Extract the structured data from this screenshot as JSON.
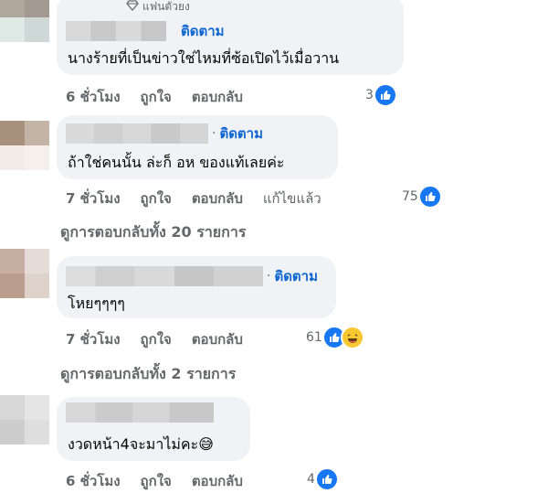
{
  "comments": [
    {
      "badge": "แฟนตัวยง",
      "follow": "ติดตาม",
      "text": "นางร้ายที่เป็นข่าวใช่ไหมที่ซ้อเปิดไว้เมื่อวาน",
      "time": "6 ชั่วโมง",
      "like": "ถูกใจ",
      "reply": "ตอบกลับ",
      "reactions": "3"
    },
    {
      "follow": "ติดตาม",
      "text": "ถ้าใช่คนนั้น ล่ะก็ อห ของแท้เลยค่ะ",
      "time": "7 ชั่วโมง",
      "like": "ถูกใจ",
      "reply": "ตอบกลับ",
      "edited": "แก้ไขแล้ว",
      "reactions": "75",
      "replies": "ดูการตอบกลับทั้ง 20 รายการ"
    },
    {
      "follow": "ติดตาม",
      "text": "โหยๆๆๆๆ",
      "time": "7 ชั่วโมง",
      "like": "ถูกใจ",
      "reply": "ตอบกลับ",
      "reactions": "61",
      "replies": "ดูการตอบกลับทั้ง 2 รายการ"
    },
    {
      "text": "งวดหน้า4จะมาไม่คะ😅",
      "time": "6 ชั่วโมง",
      "like": "ถูกใจ",
      "reply": "ตอบกลับ",
      "reactions": "4"
    }
  ],
  "colors": {
    "bubble": "#f0f2f5",
    "follow": "#0d66d0",
    "meta": "#65676b",
    "like_blue": "#1877f2"
  }
}
